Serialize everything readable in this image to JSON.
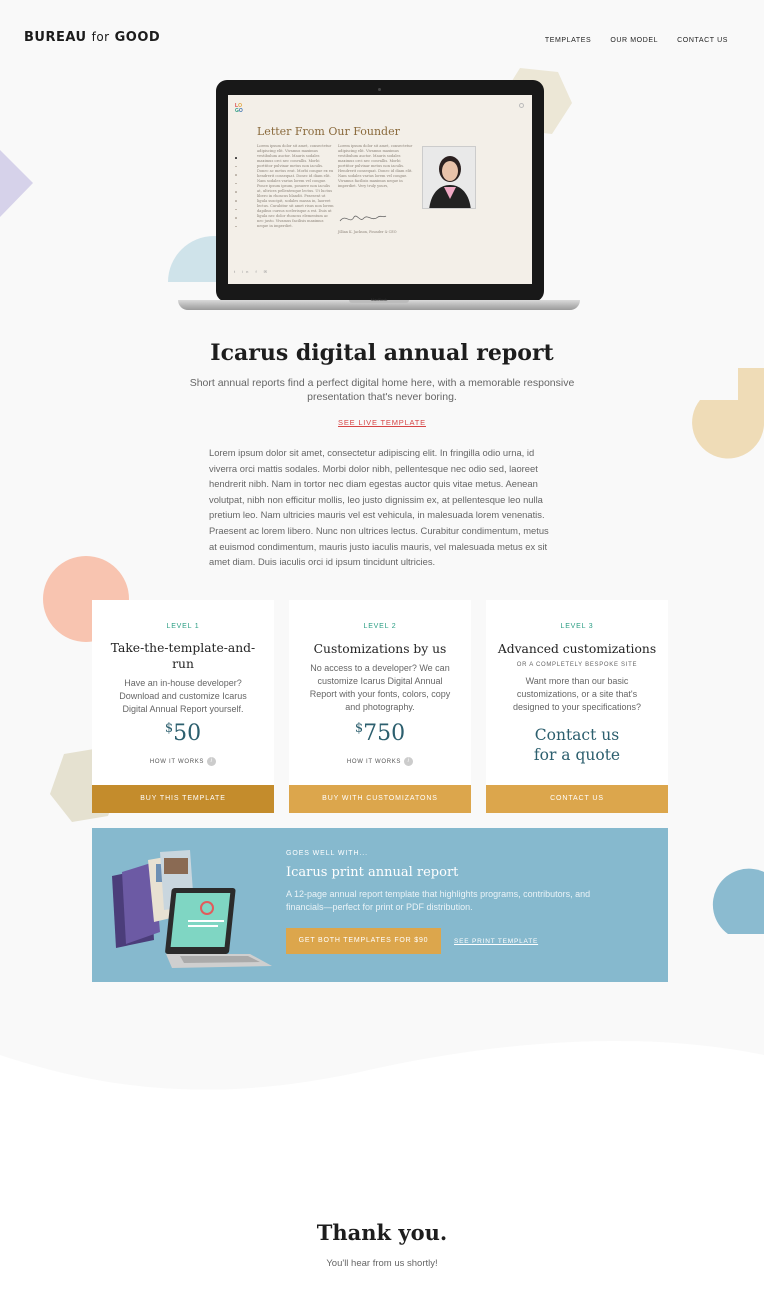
{
  "header": {
    "logo_main": "BUREAU",
    "logo_for": "for",
    "logo_end": "GOOD",
    "nav": [
      "TEMPLATES",
      "OUR MODEL",
      "CONTACT US"
    ]
  },
  "preview": {
    "logo": "LOGO",
    "title": "Letter From Our Founder",
    "col1": "Lorem ipsum dolor sit amet, consectetur adipiscing elit. Vivamus maximus vestibulum auctor. Mauris sodales maximus orci nec convallis. Morbi porttitor pulvinar metus non iaculis. Donec ac metus erat. Morbi congue ex eu hendrerit consequat. Donec id diam elit. Nam sodales varius lorem vel congue. Ponce ipsum ipsum, posuere non iaculis at, ultrices pellentesque lectus. Ut luctus libero in rhoncus blandit. Praesent ut ligula suscipit, sodales massa in, laoreet lectus. Curabitur sit amet risus non lorem dapibus cursus scelerisque a est. Duis ut ligula nec dolor rhoncus elementum ac nec justo. Vivamus facilisis maximus neque in imperdiet.",
    "col2": "Lorem ipsum dolor sit amet, consectetur adipiscing elit. Vivamus maximus vestibulum auctor. Mauris sodales maximus orci nec convallis. Morbi porttitor pulvinar metus non iaculis. Hendrerit consequat. Donec id diam elit. Nam sodales varius lorem vel congue. Vivamus facilisis maximus neque in imperdiet. Very truly yours,",
    "signer": "Jillian K. Jackson, Founder & CEO",
    "social": "t in f ✉",
    "device_label": "MacBook"
  },
  "hero": {
    "title": "Icarus digital annual report",
    "subtitle": "Short annual reports find a perfect digital home here, with a memorable responsive presentation that's never boring.",
    "live_link": "SEE LIVE TEMPLATE",
    "body": "Lorem ipsum dolor sit amet, consectetur adipiscing elit. In fringilla odio urna, id viverra orci mattis sodales. Morbi dolor nibh, pellentesque nec odio sed, laoreet hendrerit nibh. Nam in tortor nec diam egestas auctor quis vitae metus. Aenean volutpat, nibh non efficitur mollis, leo justo dignissim ex, at pellentesque leo nulla pretium leo. Nam ultricies mauris vel est vehicula, in malesuada lorem venenatis. Praesent ac lorem libero. Nunc non ultrices lectus. Curabitur condimentum, metus at euismod condimentum, mauris justo iaculis mauris, vel malesuada metus ex sit amet diam. Duis iaculis orci id ipsum tincidunt ultricies."
  },
  "cards": [
    {
      "level": "LEVEL 1",
      "title": "Take-the-template-and-run",
      "desc": "Have an in-house developer? Download and customize Icarus Digital Annual Report yourself.",
      "currency": "$",
      "price": "50",
      "how": "HOW IT WORKS",
      "button": "BUY THIS TEMPLATE",
      "button_color": "#c48c2c"
    },
    {
      "level": "LEVEL 2",
      "title": "Customizations by us",
      "desc": "No access to a developer? We can customize Icarus Digital Annual Report with your fonts, colors, copy and photography.",
      "currency": "$",
      "price": "750",
      "how": "HOW IT WORKS",
      "button": "BUY WITH CUSTOMIZATONS",
      "button_color": "#dca64c"
    },
    {
      "level": "LEVEL 3",
      "title": "Advanced customizations",
      "kicker": "OR A COMPLETELY BESPOKE SITE",
      "desc": "Want more than our basic customizations, or a site that's designed to your specifications?",
      "quote_line1": "Contact us",
      "quote_line2": "for a quote",
      "button": "CONTACT US",
      "button_color": "#dca64c"
    }
  ],
  "bundle": {
    "kicker": "GOES WELL WITH...",
    "title": "Icarus print annual report",
    "desc": "A 12-page annual report template that highlights programs, contributors, and financials—perfect for print or PDF distribution.",
    "button": "GET BOTH TEMPLATES FOR $90",
    "link": "SEE PRINT TEMPLATE",
    "bg_color": "#86b9ce"
  },
  "footer": {
    "title": "Thank you.",
    "subtitle": "You'll hear from us shortly!"
  }
}
